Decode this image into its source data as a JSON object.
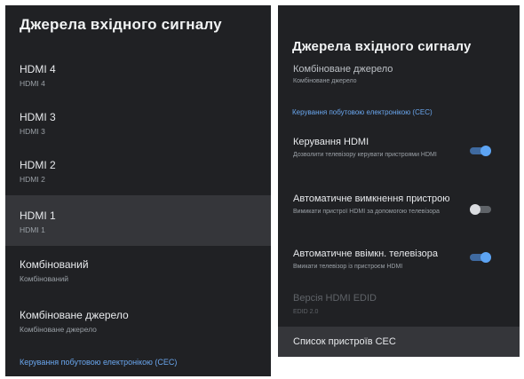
{
  "left": {
    "title": "Джерела вхідного сигналу",
    "items": [
      {
        "label": "HDMI 4",
        "sub": "HDMI 4"
      },
      {
        "label": "HDMI 3",
        "sub": "HDMI 3"
      },
      {
        "label": "HDMI 2",
        "sub": "HDMI 2"
      },
      {
        "label": "HDMI 1",
        "sub": "HDMI 1"
      },
      {
        "label": "Комбінований",
        "sub": "Комбінований"
      },
      {
        "label": "Комбіноване джерело",
        "sub": "Комбіноване джерело"
      }
    ],
    "selected_item": "HDMI 1",
    "section": "Керування побутовою електронікою (CEC)"
  },
  "right": {
    "title": "Джерела вхідного сигналу",
    "partial_item": {
      "label": "Комбіноване джерело",
      "sub": "Комбіноване джерело"
    },
    "section": "Керування побутовою електронікою (CEC)",
    "settings": [
      {
        "label": "Керування HDMI",
        "sub": "Дозволити телевізору керувати пристроями HDMI",
        "toggle": "on"
      },
      {
        "label": "Автоматичне вимкнення пристрою",
        "sub": "Вимикати пристрої HDMI за допомогою телевізора",
        "toggle": "off"
      },
      {
        "label": "Автоматичне ввімкн. телевізора",
        "sub": "Вмикати телевізор із пристроєм HDMI",
        "toggle": "on"
      }
    ],
    "edid": {
      "label": "Версія HDMI EDID",
      "sub": "EDID 2.0"
    },
    "device_list": {
      "label": "Список пристроїв CEC"
    }
  },
  "colors": {
    "panel_bg": "#202124",
    "selected_bg": "#35363a",
    "accent": "#5da4f3",
    "section_text": "#6aa7ef"
  }
}
